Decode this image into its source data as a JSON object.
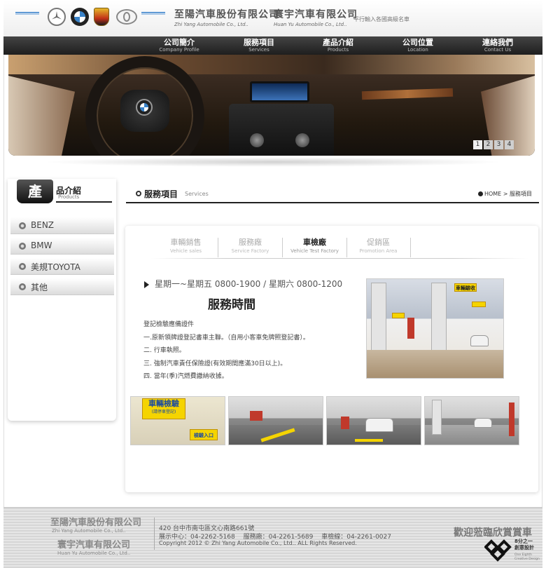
{
  "header": {
    "company_a_zh": "至陽汽車股份有限公司",
    "company_a_en": "Zhi Yang Automobile Co., Ltd..",
    "separator": "‧",
    "company_b_zh": "寰宇汽車有限公司",
    "company_b_en": "Huan Yu Automobile Co., Ltd..",
    "tagline": "平行輸入各國高級名車",
    "brand_logos": [
      "benz-logo",
      "bmw-logo",
      "porsche-logo",
      "toyota-logo"
    ]
  },
  "nav": [
    {
      "zh": "公司簡介",
      "en": "Company Profile"
    },
    {
      "zh": "服務項目",
      "en": "Services"
    },
    {
      "zh": "產品介紹",
      "en": "Products"
    },
    {
      "zh": "公司位置",
      "en": "Location"
    },
    {
      "zh": "連絡我們",
      "en": "Contact Us"
    }
  ],
  "banner": {
    "pages": [
      "1",
      "2",
      "3",
      "4"
    ],
    "active_page": "1"
  },
  "sidebar": {
    "badge": "產",
    "title": "品介紹",
    "title_en": "Products",
    "items": [
      "BENZ",
      "BMW",
      "美規TOYOTA",
      "其他"
    ]
  },
  "content_header": {
    "title": "服務項目",
    "subtitle": "Services",
    "breadcrumb": "HOME > 服務項目"
  },
  "tabs": [
    {
      "zh": "車輛銷售",
      "en": "Vehicle sales",
      "active": false
    },
    {
      "zh": "服務廠",
      "en": "Service Factory",
      "active": false
    },
    {
      "zh": "車檢廠",
      "en": "Vehicle Test Factory",
      "active": true
    },
    {
      "zh": "促銷區",
      "en": "Promotion Area",
      "active": false
    }
  ],
  "service": {
    "hours": "星期一~星期五 0800-1900 / 星期六 0800-1200",
    "hours_title": "服務時間",
    "requirements": [
      "登記檢驗應備證件",
      "一.原新領牌證登記書車主聯。（自用小客車免牌照登記書）。",
      "二. 行車執照。",
      "三. 強制汽車責任保險證(有效期間應滿30日以上)。",
      "四. 當年(季)汽燃費繳納收據。"
    ],
    "main_photo_sign": "車輛驗收",
    "thumb_signs": [
      "車輛檢驗",
      "(請停車登記)",
      "檢驗入口"
    ]
  },
  "footer": {
    "company_a_zh": "至陽汽車股份有限公司",
    "company_a_en": "Zhi Yang Automobile Co., Ltd..",
    "company_b_zh": "寰宇汽車有限公司",
    "company_b_en": "Huan Yu Automobile Co., Ltd..",
    "address": "420 台中市南屯區文心南路661號",
    "phones": "展示中心：04-2262-5168　 服務廠：04-2261-5689　 車檢線：04-2261-0027",
    "copyright": "Copyright 2012 © Zhi Yang Automobile Co., Ltd.. ALL Rights Reserved.",
    "welcome": "歡迎蒞臨欣賞賞車",
    "designer_zh": "8分之一",
    "designer_zh2": "創意設計",
    "designer_en": "One Eighth",
    "designer_en2": "Creative Design"
  },
  "colors": {
    "nav_bg": "#2a2a2a",
    "accent_blue": "#2b78c8",
    "sign_yellow": "#f5d400"
  }
}
